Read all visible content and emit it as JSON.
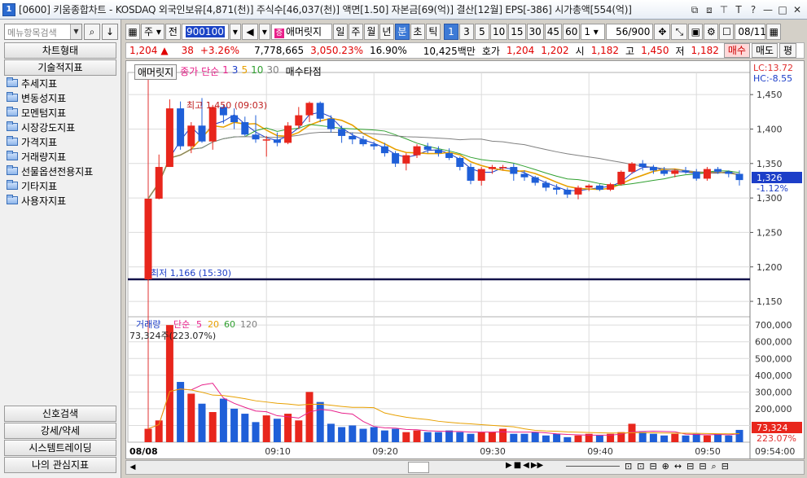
{
  "window": {
    "title": "[0600] 키움종합차트 - KOSDAQ 외국인보유[4,871(천)] 주식수[46,037(천)] 액면[1.50] 자본금[69(억)] 결산[12월] EPS[-386] 시가총액[554(억)]",
    "app_icon": "1",
    "buttons": [
      "⧉",
      "⧈",
      "⊤",
      "T",
      "?",
      "—",
      "□",
      "✕"
    ]
  },
  "left_panel": {
    "search_placeholder": "메뉴항목검색",
    "tab_chart_type": "차트형태",
    "tab_indicators": "기술적지표",
    "tree": [
      "추세지표",
      "변동성지표",
      "모멘텀지표",
      "시장강도지표",
      "가격지표",
      "거래량지표",
      "선물옵션전용지표",
      "기타지표",
      "사용자지표"
    ],
    "bottom_buttons": [
      "신호검색",
      "강세/약세",
      "시스템트레이딩",
      "나의 관심지표"
    ]
  },
  "toolbar": {
    "market": "주",
    "prefix": "전",
    "code": "900100",
    "name": "애머릿지",
    "periods": [
      "일",
      "주",
      "월",
      "년",
      "분",
      "초",
      "틱"
    ],
    "selected_period": "분",
    "intervals": [
      "1",
      "3",
      "5",
      "10",
      "15",
      "30",
      "45",
      "60"
    ],
    "selected_interval": "1",
    "custom_interval": "1",
    "count": "56",
    "count_total": "/900",
    "date": "08/11"
  },
  "infobar": {
    "price": "1,204",
    "change_arrow": "▲",
    "change": "38",
    "change_rate": "+3.26%",
    "volume": "7,778,665",
    "volume_rate": "3,050.23%",
    "turnover": "16.90%",
    "amount": "10,425백만",
    "quote_label": "호가",
    "ask": "1,204",
    "bid": "1,202",
    "open_label": "시",
    "open": "1,182",
    "high_label": "고",
    "high": "1,450",
    "low_label": "저",
    "low": "1,182",
    "buy": "매수",
    "sell": "매도",
    "eval": "평"
  },
  "chart_data": {
    "type": "candlestick",
    "date_label": "08/08",
    "time_end": "09:54:00",
    "x_ticks": [
      "09:10",
      "09:20",
      "09:30",
      "09:40",
      "09:50"
    ],
    "price_ticks": [
      "1,450",
      "1,400",
      "1,350",
      "1,300",
      "1,250",
      "1,200",
      "1,150"
    ],
    "volume_ticks": [
      "700,000",
      "600,000",
      "500,000",
      "400,000",
      "300,000",
      "200,000",
      "100,000"
    ],
    "legend": {
      "name": "애머릿지",
      "ma_label": "종가 단순",
      "ma_periods": [
        "1",
        "3",
        "5",
        "10",
        "30"
      ],
      "marker": "매수타점"
    },
    "vol_legend": {
      "label": "거래량",
      "ma_label": "단순",
      "periods": [
        "5",
        "20",
        "60",
        "120"
      ],
      "value_text": "73,324주(223.07%)"
    },
    "high_annotation": "최고 1,450 (09:03)",
    "low_annotation": "최저 1,166 (15:30)",
    "lc_label": "LC:13.72",
    "hc_label": "HC:-8.55",
    "last_price_label": "1,326",
    "last_change_label": "-1.12%",
    "last_volume_label": "73,324",
    "last_volume_rate": "223.07%",
    "price_range": [
      1130,
      1475
    ],
    "volume_range": [
      0,
      730000
    ],
    "hline_price": 1182,
    "candles": [
      [
        1182,
        1299,
        1179,
        1299
      ],
      [
        1299,
        1363,
        1298,
        1345
      ],
      [
        1345,
        1443,
        1345,
        1430
      ],
      [
        1430,
        1440,
        1370,
        1375
      ],
      [
        1375,
        1410,
        1365,
        1405
      ],
      [
        1405,
        1445,
        1380,
        1382
      ],
      [
        1382,
        1435,
        1370,
        1432
      ],
      [
        1432,
        1436,
        1408,
        1420
      ],
      [
        1420,
        1430,
        1400,
        1410
      ],
      [
        1410,
        1418,
        1390,
        1392
      ],
      [
        1392,
        1420,
        1380,
        1385
      ],
      [
        1385,
        1390,
        1360,
        1385
      ],
      [
        1385,
        1395,
        1375,
        1380
      ],
      [
        1380,
        1410,
        1378,
        1405
      ],
      [
        1405,
        1432,
        1400,
        1420
      ],
      [
        1420,
        1440,
        1410,
        1438
      ],
      [
        1438,
        1440,
        1410,
        1415
      ],
      [
        1415,
        1420,
        1395,
        1400
      ],
      [
        1400,
        1405,
        1380,
        1390
      ],
      [
        1390,
        1395,
        1378,
        1385
      ],
      [
        1385,
        1390,
        1375,
        1378
      ],
      [
        1378,
        1382,
        1370,
        1375
      ],
      [
        1375,
        1380,
        1360,
        1365
      ],
      [
        1365,
        1368,
        1345,
        1350
      ],
      [
        1350,
        1365,
        1340,
        1362
      ],
      [
        1362,
        1378,
        1358,
        1375
      ],
      [
        1375,
        1380,
        1365,
        1370
      ],
      [
        1370,
        1375,
        1360,
        1365
      ],
      [
        1365,
        1372,
        1355,
        1358
      ],
      [
        1358,
        1360,
        1340,
        1345
      ],
      [
        1345,
        1350,
        1320,
        1325
      ],
      [
        1325,
        1345,
        1318,
        1342
      ],
      [
        1342,
        1348,
        1335,
        1345
      ],
      [
        1345,
        1348,
        1340,
        1345
      ],
      [
        1345,
        1350,
        1325,
        1335
      ],
      [
        1335,
        1340,
        1325,
        1330
      ],
      [
        1330,
        1332,
        1318,
        1322
      ],
      [
        1322,
        1325,
        1310,
        1315
      ],
      [
        1315,
        1320,
        1305,
        1312
      ],
      [
        1312,
        1315,
        1300,
        1305
      ],
      [
        1305,
        1318,
        1298,
        1315
      ],
      [
        1315,
        1320,
        1310,
        1318
      ],
      [
        1318,
        1320,
        1310,
        1312
      ],
      [
        1312,
        1322,
        1310,
        1320
      ],
      [
        1320,
        1340,
        1318,
        1338
      ],
      [
        1338,
        1352,
        1335,
        1350
      ],
      [
        1350,
        1355,
        1340,
        1345
      ],
      [
        1345,
        1348,
        1335,
        1340
      ],
      [
        1340,
        1345,
        1332,
        1335
      ],
      [
        1335,
        1342,
        1330,
        1340
      ],
      [
        1340,
        1345,
        1335,
        1338
      ],
      [
        1338,
        1342,
        1325,
        1328
      ],
      [
        1328,
        1345,
        1325,
        1342
      ],
      [
        1342,
        1345,
        1335,
        1338
      ],
      [
        1338,
        1340,
        1330,
        1335
      ],
      [
        1335,
        1340,
        1318,
        1326
      ]
    ],
    "volumes": [
      80000,
      130000,
      700000,
      360000,
      290000,
      230000,
      180000,
      260000,
      200000,
      170000,
      120000,
      160000,
      140000,
      170000,
      130000,
      300000,
      240000,
      110000,
      90000,
      100000,
      80000,
      90000,
      70000,
      80000,
      60000,
      70000,
      60000,
      60000,
      70000,
      60000,
      50000,
      60000,
      60000,
      80000,
      50000,
      50000,
      60000,
      40000,
      50000,
      30000,
      40000,
      50000,
      40000,
      50000,
      60000,
      110000,
      60000,
      50000,
      40000,
      50000,
      40000,
      50000,
      40000,
      50000,
      40000,
      73324
    ]
  }
}
